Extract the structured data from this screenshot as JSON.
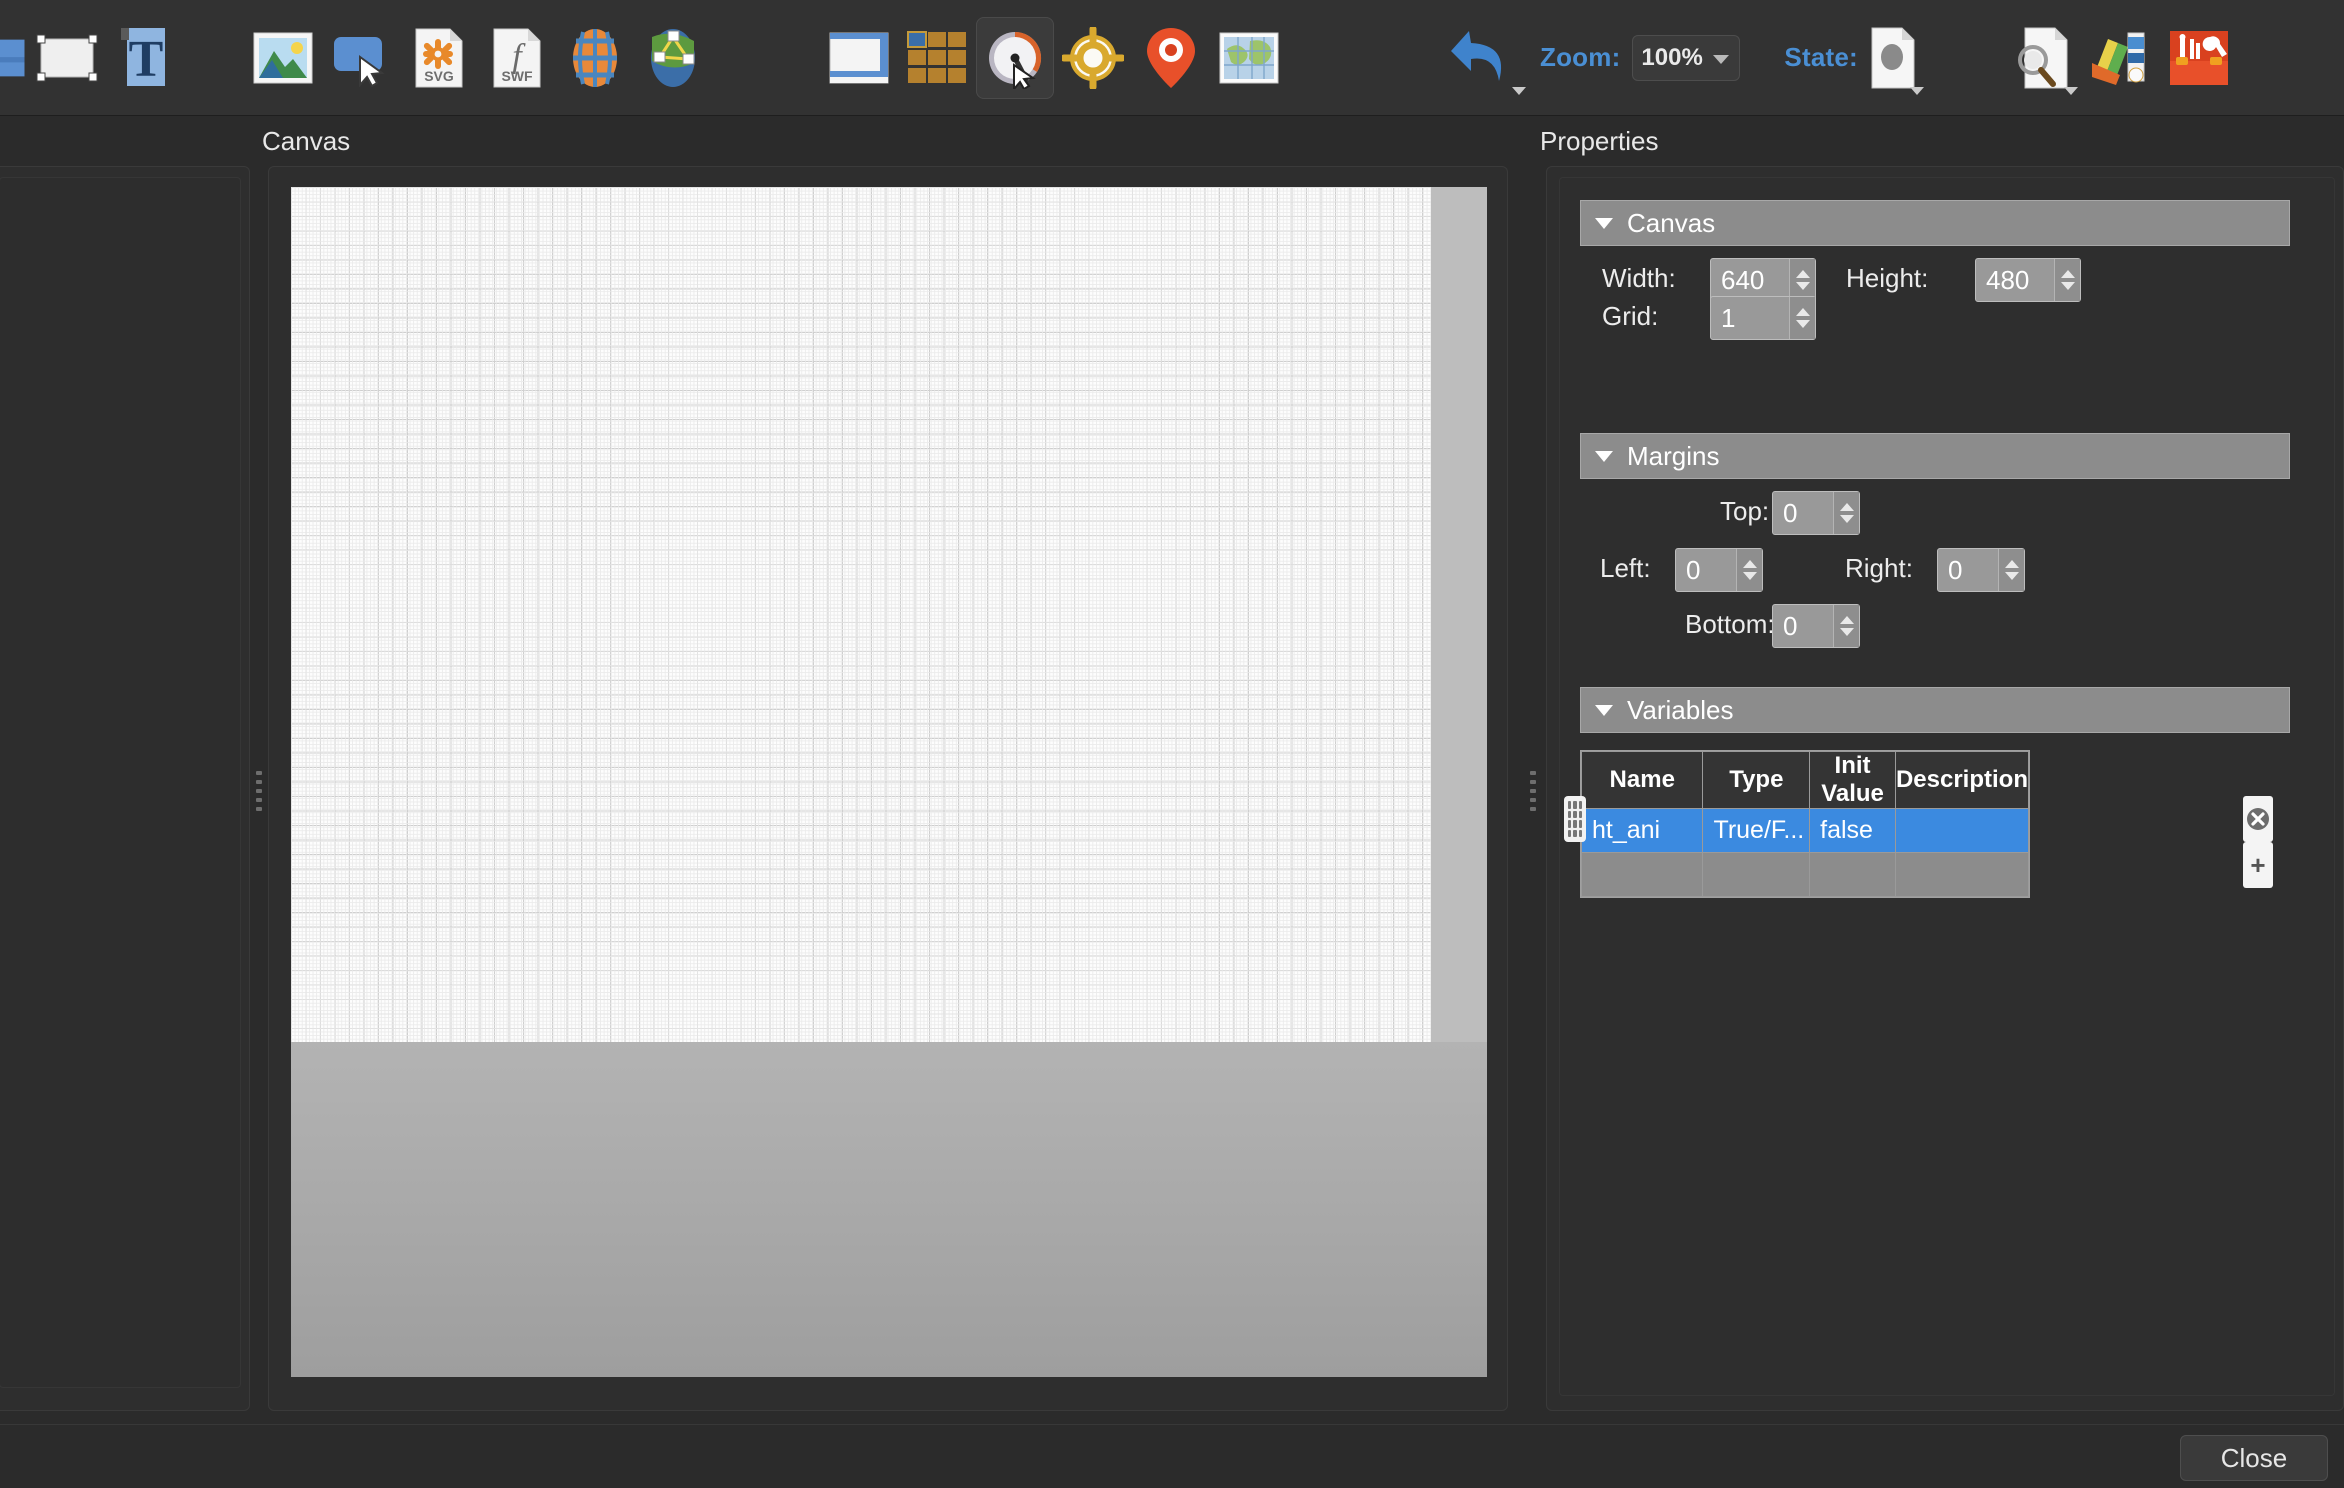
{
  "toolbar": {
    "tools": [
      {
        "name": "rectangle-fill-tool",
        "icon": "blue-square-icon"
      },
      {
        "name": "rectangle-shape-tool",
        "icon": "white-rectangle-handles-icon"
      },
      {
        "name": "text-tool",
        "icon": "text-T-icon"
      },
      {
        "name": "image-tool",
        "icon": "picture-icon"
      },
      {
        "name": "button-tool",
        "icon": "button-cursor-icon"
      },
      {
        "name": "svg-tool",
        "icon": "svg-file-icon",
        "label": "SVG"
      },
      {
        "name": "swf-tool",
        "icon": "swf-file-icon",
        "label": "SWF"
      },
      {
        "name": "globe-tool",
        "icon": "globe-orange-icon"
      },
      {
        "name": "network-tool",
        "icon": "globe-network-icon"
      },
      {
        "name": "window-tool",
        "icon": "window-layout-icon"
      },
      {
        "name": "grid-tool",
        "icon": "grid-tiles-icon"
      },
      {
        "name": "gauge-tool",
        "icon": "gauge-icon",
        "selected": true
      },
      {
        "name": "target-tool",
        "icon": "crosshair-target-icon"
      },
      {
        "name": "marker-tool",
        "icon": "map-pin-icon"
      },
      {
        "name": "map-tool",
        "icon": "world-map-icon"
      }
    ],
    "undo": {
      "name": "undo-button",
      "icon": "undo-arrow-icon"
    },
    "zoom": {
      "label": "Zoom:",
      "value": "100%"
    },
    "state": {
      "label": "State:",
      "icon": "state-document-icon"
    },
    "right_tools": [
      {
        "name": "inspect-tool",
        "icon": "document-magnifier-icon"
      },
      {
        "name": "palette-tool",
        "icon": "color-swatches-icon"
      },
      {
        "name": "toolbox-tool",
        "icon": "toolbox-icon"
      }
    ]
  },
  "panes": {
    "canvas_title": "Canvas",
    "properties_title": "Properties"
  },
  "properties": {
    "canvas_section": {
      "title": "Canvas",
      "width_label": "Width:",
      "width_value": "640",
      "height_label": "Height:",
      "height_value": "480",
      "grid_label": "Grid:",
      "grid_value": "1"
    },
    "margins_section": {
      "title": "Margins",
      "top_label": "Top:",
      "top_value": "0",
      "left_label": "Left:",
      "left_value": "0",
      "right_label": "Right:",
      "right_value": "0",
      "bottom_label": "Bottom:",
      "bottom_value": "0"
    },
    "variables_section": {
      "title": "Variables",
      "columns": [
        "Name",
        "Type",
        "Init Value",
        "Description"
      ],
      "rows": [
        {
          "name": "ht_ani",
          "type": "True/F...",
          "init": "false",
          "description": "",
          "selected": true
        },
        {
          "name": "",
          "type": "",
          "init": "",
          "description": "",
          "selected": false
        }
      ],
      "delete_button": "✖",
      "add_button": "+"
    }
  },
  "footer": {
    "close_label": "Close"
  },
  "colors": {
    "app_background": "#2b2b2b",
    "toolbar_background": "#323232",
    "accent_blue": "#4a8fd4",
    "selection_blue": "#3b8ae0",
    "section_header_gray": "#8c8c8c",
    "field_gray": "#999999"
  }
}
